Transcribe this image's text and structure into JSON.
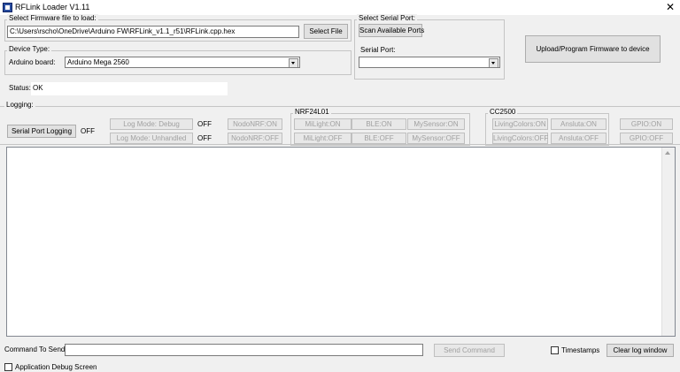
{
  "window": {
    "title": "RFLink Loader V1.11",
    "close": "✕"
  },
  "firmware_group": {
    "legend": "Select Firmware file to load:",
    "path_value": "C:\\Users\\rscho\\OneDrive\\Arduino FW\\RFLink_v1.1_r51\\RFLink.cpp.hex",
    "select_button": "Select File"
  },
  "device_group": {
    "legend": "Device Type:",
    "board_label": "Arduino board:",
    "board_value": "Arduino Mega 2560"
  },
  "serial_group": {
    "legend": "Select Serial Port:",
    "scan_button": "Scan Available Ports",
    "port_label": "Serial Port:",
    "port_value": ""
  },
  "upload_button": "Upload/Program Firmware to device",
  "status": {
    "label": "Status:",
    "value": "OK"
  },
  "logging": {
    "legend": "Logging:",
    "serial_port_logging_button": "Serial Port Logging",
    "serial_port_logging_state": "OFF",
    "log_mode_debug_button": "Log Mode: Debug",
    "log_mode_debug_state": "OFF",
    "log_mode_unhandled_button": "Log Mode: Unhandled",
    "log_mode_unhandled_state": "OFF",
    "nodo_nrf_on": "NodoNRF:ON",
    "nodo_nrf_off": "NodoNRF:OFF"
  },
  "nrf24": {
    "legend": "NRF24L01",
    "milight_on": "MiLight:ON",
    "milight_off": "MiLight:OFF",
    "ble_on": "BLE:ON",
    "ble_off": "BLE:OFF",
    "mysensor_on": "MySensor:ON",
    "mysensor_off": "MySensor:OFF"
  },
  "cc2500": {
    "legend": "CC2500",
    "livingcolors_on": "LivingColors:ON",
    "livingcolors_off": "LivingColors:OFF",
    "ansluta_on": "Ansluta:ON",
    "ansluta_off": "Ansluta:OFF"
  },
  "gpio": {
    "on": "GPIO:ON",
    "off": "GPIO:OFF"
  },
  "command": {
    "label": "Command To Send:",
    "value": "",
    "send_button": "Send Command",
    "timestamps_label": "Timestamps",
    "clear_button": "Clear log window"
  },
  "debug_screen_label": "Application Debug Screen",
  "icons": {
    "app": "app-window-icon",
    "close": "close-icon",
    "combo": "chevron-down-icon"
  }
}
